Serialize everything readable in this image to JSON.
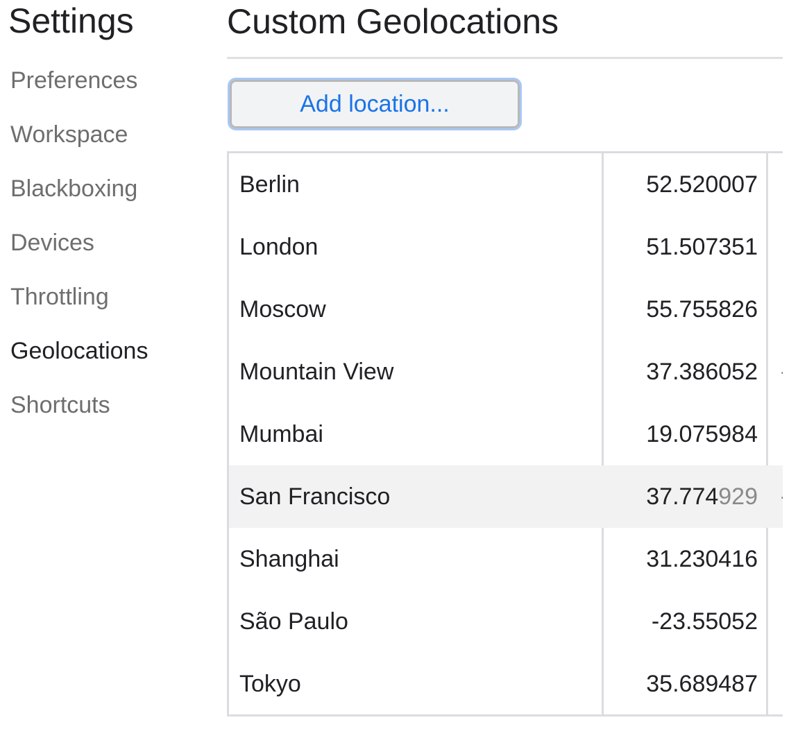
{
  "sidebar": {
    "title": "Settings",
    "items": [
      {
        "label": "Preferences",
        "selected": false
      },
      {
        "label": "Workspace",
        "selected": false
      },
      {
        "label": "Blackboxing",
        "selected": false
      },
      {
        "label": "Devices",
        "selected": false
      },
      {
        "label": "Throttling",
        "selected": false
      },
      {
        "label": "Geolocations",
        "selected": true
      },
      {
        "label": "Shortcuts",
        "selected": false
      }
    ]
  },
  "main": {
    "title": "Custom Geolocations",
    "add_button_label": "Add location...",
    "locations": [
      {
        "name": "Berlin",
        "latitude": "52.520007",
        "longitude_visible": ""
      },
      {
        "name": "London",
        "latitude": "51.507351",
        "longitude_visible": ""
      },
      {
        "name": "Moscow",
        "latitude": "55.755826",
        "longitude_visible": ""
      },
      {
        "name": "Mountain View",
        "latitude": "37.386052",
        "longitude_visible": "-"
      },
      {
        "name": "Mumbai",
        "latitude": "19.075984",
        "longitude_visible": ""
      },
      {
        "name": "San Francisco",
        "latitude": "37.774929",
        "longitude_visible": "-",
        "hovered": true
      },
      {
        "name": "Shanghai",
        "latitude": "31.230416",
        "longitude_visible": ""
      },
      {
        "name": "São Paulo",
        "latitude": "-23.55052",
        "longitude_visible": ""
      },
      {
        "name": "Tokyo",
        "latitude": "35.689487",
        "longitude_visible": ""
      }
    ]
  },
  "colors": {
    "text_primary": "#202124",
    "text_secondary": "#6e6e6e",
    "accent_blue": "#1a73e8",
    "focus_ring": "#a9c7f5",
    "divider": "#dadce0",
    "hover_row": "#f2f2f2"
  }
}
